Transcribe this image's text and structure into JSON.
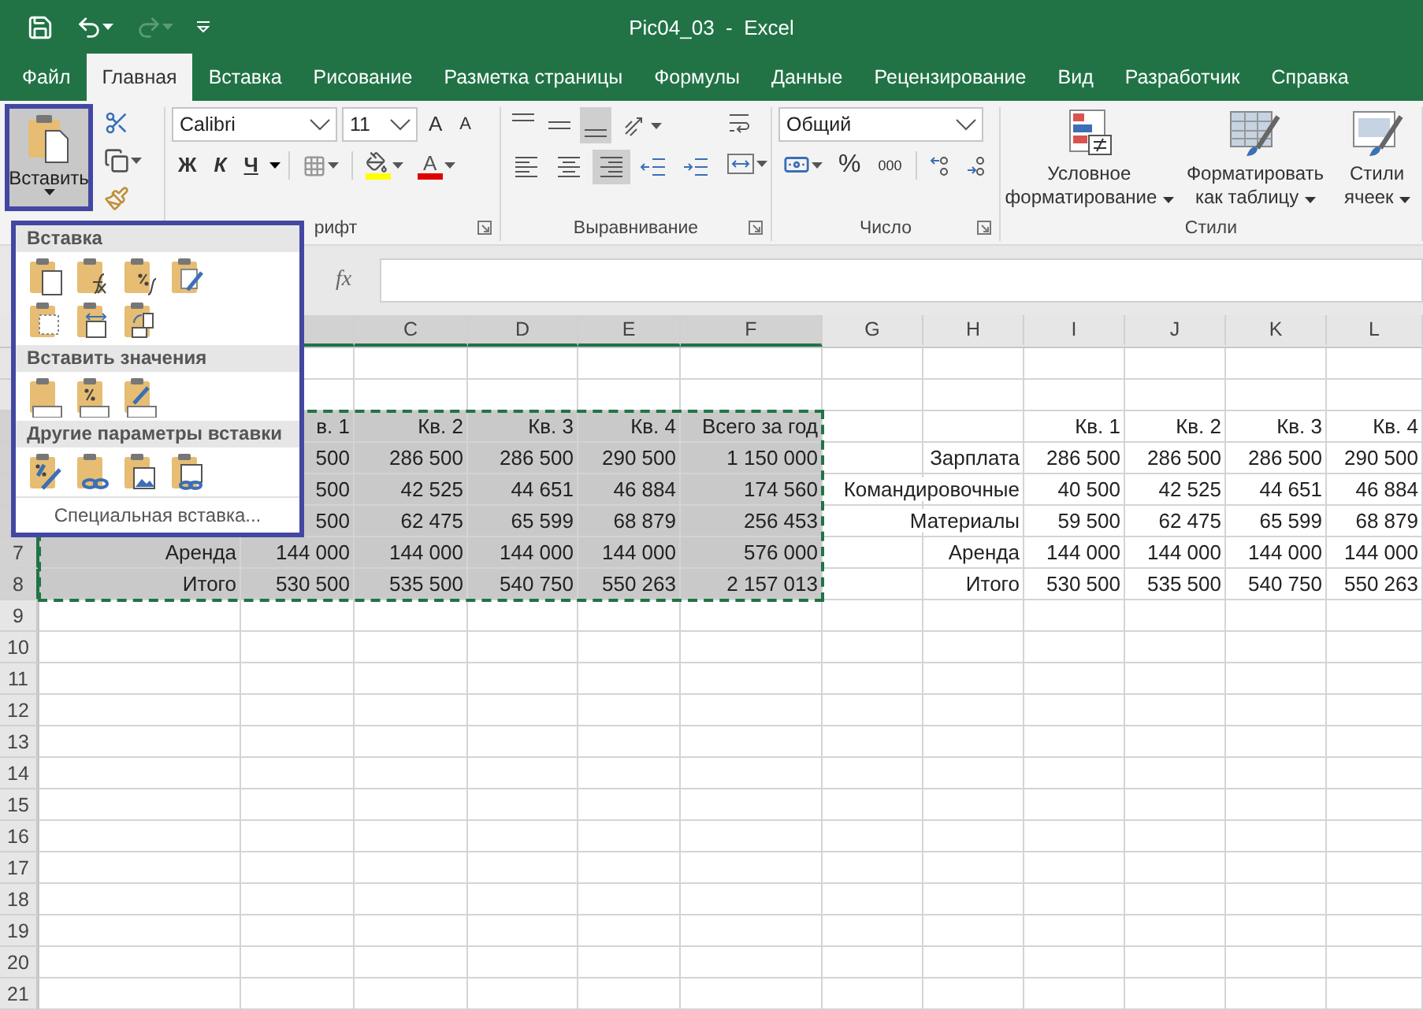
{
  "window": {
    "title": "Pic04_03  -  Excel"
  },
  "quick_access": [
    {
      "kind": "save",
      "disabled": false
    },
    {
      "kind": "undo",
      "disabled": false
    },
    {
      "kind": "redo",
      "disabled": true
    },
    {
      "kind": "customize",
      "disabled": false
    }
  ],
  "tabs": [
    {
      "label": "Файл",
      "selected": false
    },
    {
      "label": "Главная",
      "selected": true
    },
    {
      "label": "Вставка",
      "selected": false
    },
    {
      "label": "Рисование",
      "selected": false
    },
    {
      "label": "Разметка страницы",
      "selected": false
    },
    {
      "label": "Формулы",
      "selected": false
    },
    {
      "label": "Данные",
      "selected": false
    },
    {
      "label": "Рецензирование",
      "selected": false
    },
    {
      "label": "Вид",
      "selected": false
    },
    {
      "label": "Разработчик",
      "selected": false
    },
    {
      "label": "Справка",
      "selected": false
    }
  ],
  "ribbon": {
    "clipboard": {
      "paste_label": "Вставить"
    },
    "font": {
      "label": "рифт",
      "name": "Calibri",
      "size": "11",
      "grow": "A",
      "shrink": "A",
      "bold": "Ж",
      "italic": "К",
      "underline": "Ч",
      "font_color": "A"
    },
    "alignment": {
      "label": "Выравнивание",
      "vertical": [
        {
          "kind": "top",
          "selected": false
        },
        {
          "kind": "middle",
          "selected": false
        },
        {
          "kind": "bottom",
          "selected": true
        }
      ],
      "horizontal": [
        {
          "kind": "left",
          "selected": false
        },
        {
          "kind": "center",
          "selected": false
        },
        {
          "kind": "right",
          "selected": true
        }
      ]
    },
    "number": {
      "label": "Число",
      "format": "Общий",
      "percent": "%",
      "thousands": "000"
    },
    "styles": {
      "label": "Стили",
      "buttons": [
        {
          "kind": "conditional",
          "label": "Условное форматирование"
        },
        {
          "kind": "table",
          "label": "Форматировать как таблицу"
        },
        {
          "kind": "cell",
          "label": "Стили ячеек"
        }
      ]
    }
  },
  "formula_bar": {
    "function_label": "fx"
  },
  "sheet": {
    "columns": [
      {
        "selected": true
      },
      {
        "selected": true
      },
      {
        "label": "C",
        "selected": true
      },
      {
        "label": "D",
        "selected": true
      },
      {
        "label": "E",
        "selected": true
      },
      {
        "label": "F",
        "selected": true
      },
      {
        "label": "G",
        "selected": false
      },
      {
        "label": "H",
        "selected": false
      },
      {
        "label": "I",
        "selected": false
      },
      {
        "label": "J",
        "selected": false
      },
      {
        "label": "K",
        "selected": false
      },
      {
        "label": "L",
        "selected": false
      }
    ],
    "rows": [
      {
        "selected": false
      },
      {
        "selected": false
      },
      {
        "selected": true,
        "cells": [
          {},
          {
            "text": "в. 1"
          },
          {
            "text": "Кв. 2"
          },
          {
            "text": "Кв. 3"
          },
          {
            "text": "Кв. 4"
          },
          {
            "text": "Всего за год"
          },
          {},
          {},
          {
            "text": "Кв. 1"
          },
          {
            "text": "Кв. 2"
          },
          {
            "text": "Кв. 3"
          },
          {
            "text": "Кв. 4"
          }
        ]
      },
      {
        "selected": true,
        "cells": [
          {},
          {
            "text": "500"
          },
          {
            "text": "286 500"
          },
          {
            "text": "286 500"
          },
          {
            "text": "290 500"
          },
          {
            "text": "1 150 000"
          },
          {},
          {
            "text": "Зарплата"
          },
          {
            "text": "286 500"
          },
          {
            "text": "286 500"
          },
          {
            "text": "286 500"
          },
          {
            "text": "290 500"
          }
        ]
      },
      {
        "selected": true,
        "cells": [
          {},
          {
            "text": "500"
          },
          {
            "text": "42 525"
          },
          {
            "text": "44 651"
          },
          {
            "text": "46 884"
          },
          {
            "text": "174 560"
          },
          {},
          {
            "text": "Командировочные"
          },
          {
            "text": "40 500"
          },
          {
            "text": "42 525"
          },
          {
            "text": "44 651"
          },
          {
            "text": "46 884"
          }
        ]
      },
      {
        "selected": true,
        "cells": [
          {},
          {
            "text": "500"
          },
          {
            "text": "62 475"
          },
          {
            "text": "65 599"
          },
          {
            "text": "68 879"
          },
          {
            "text": "256 453"
          },
          {},
          {
            "text": "Материалы"
          },
          {
            "text": "59 500"
          },
          {
            "text": "62 475"
          },
          {
            "text": "65 599"
          },
          {
            "text": "68 879"
          }
        ]
      },
      {
        "number": "7",
        "selected": true,
        "cells": [
          {
            "text": "Аренда"
          },
          {
            "text": "144 000"
          },
          {
            "text": "144 000"
          },
          {
            "text": "144 000"
          },
          {
            "text": "144 000"
          },
          {
            "text": "576 000"
          },
          {},
          {
            "text": "Аренда"
          },
          {
            "text": "144 000"
          },
          {
            "text": "144 000"
          },
          {
            "text": "144 000"
          },
          {
            "text": "144 000"
          }
        ]
      },
      {
        "number": "8",
        "selected": true,
        "cells": [
          {
            "text": "Итого"
          },
          {
            "text": "530 500"
          },
          {
            "text": "535 500"
          },
          {
            "text": "540 750"
          },
          {
            "text": "550 263"
          },
          {
            "text": "2 157 013"
          },
          {},
          {
            "text": "Итого"
          },
          {
            "text": "530 500"
          },
          {
            "text": "535 500"
          },
          {
            "text": "540 750"
          },
          {
            "text": "550 263"
          }
        ]
      },
      {
        "number": "9",
        "selected": false
      },
      {
        "number": "10",
        "selected": false
      },
      {
        "number": "11",
        "selected": false
      },
      {
        "number": "12",
        "selected": false
      },
      {
        "number": "13",
        "selected": false
      },
      {
        "number": "14",
        "selected": false
      },
      {
        "number": "15",
        "selected": false
      },
      {
        "number": "16",
        "selected": false
      },
      {
        "number": "17",
        "selected": false
      },
      {
        "number": "18",
        "selected": false
      },
      {
        "number": "19",
        "selected": false
      },
      {
        "number": "20",
        "selected": false
      },
      {
        "number": "21",
        "selected": false
      }
    ]
  },
  "paste_menu": {
    "sections": [
      {
        "title": "Вставка",
        "items": [
          {
            "kind": "paste"
          },
          {
            "kind": "formulas"
          },
          {
            "kind": "formulas_number"
          },
          {
            "kind": "keep_source"
          },
          {
            "kind": "no_borders"
          },
          {
            "kind": "keep_widths"
          },
          {
            "kind": "transpose"
          }
        ]
      },
      {
        "title": "Вставить значения",
        "items": [
          {
            "kind": "values"
          },
          {
            "kind": "values_number"
          },
          {
            "kind": "values_source"
          }
        ]
      },
      {
        "title": "Другие параметры вставки",
        "items": [
          {
            "kind": "formatting"
          },
          {
            "kind": "link"
          },
          {
            "kind": "picture"
          },
          {
            "kind": "linked_picture"
          }
        ]
      }
    ],
    "footer": "Специальная вставка..."
  }
}
